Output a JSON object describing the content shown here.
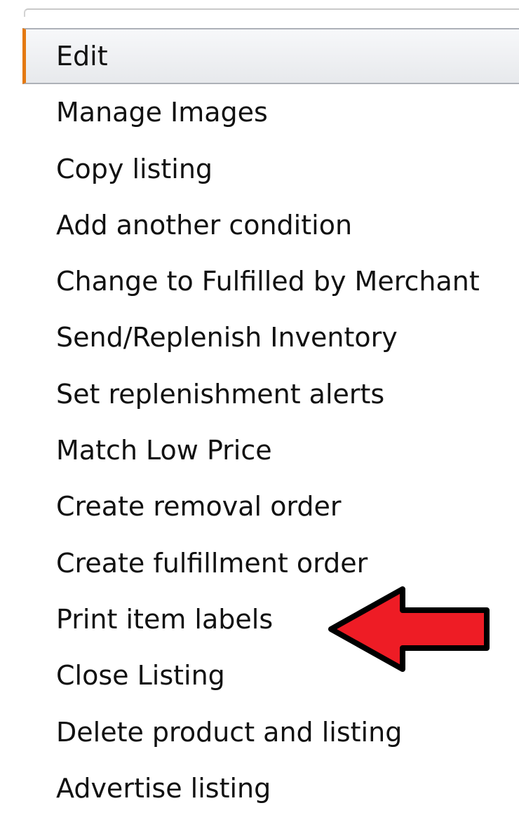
{
  "menu": {
    "items": [
      {
        "label": "Edit",
        "selected": true
      },
      {
        "label": "Manage Images"
      },
      {
        "label": "Copy listing"
      },
      {
        "label": "Add another condition"
      },
      {
        "label": "Change to Fulfilled by Merchant"
      },
      {
        "label": "Send/Replenish Inventory"
      },
      {
        "label": "Set replenishment alerts"
      },
      {
        "label": "Match Low Price"
      },
      {
        "label": "Create removal order"
      },
      {
        "label": "Create fulfillment order"
      },
      {
        "label": "Print item labels"
      },
      {
        "label": "Close Listing"
      },
      {
        "label": "Delete product and listing"
      },
      {
        "label": "Advertise listing"
      }
    ]
  },
  "annotation": {
    "icon": "left-arrow-icon",
    "color": "#ee1c25",
    "points_to": "Print item labels"
  },
  "colors": {
    "selected_accent": "#e47911",
    "text": "#111111"
  }
}
